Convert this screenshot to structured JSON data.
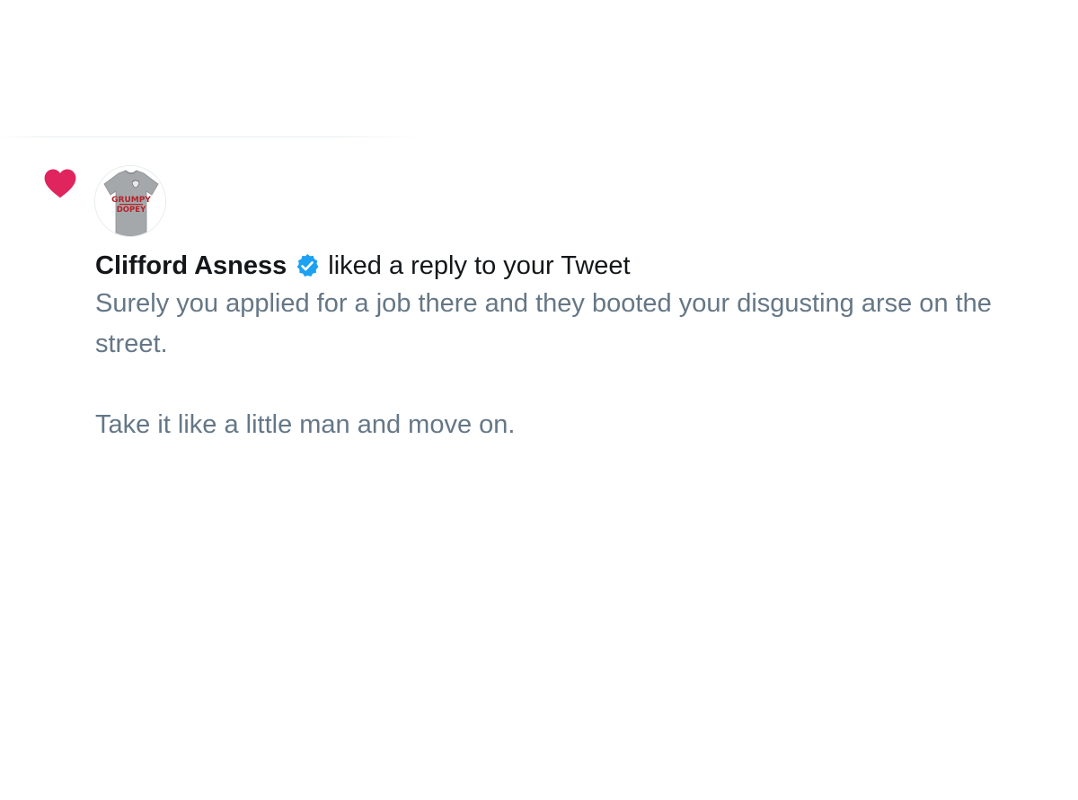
{
  "notification": {
    "type_icon": "heart-icon",
    "avatar_icon": "t-shirt-avatar",
    "avatar_text_line1": "GRUMPY",
    "avatar_text_line2": "DOPEY",
    "user_name": "Clifford Asness",
    "verified_icon": "verified-badge-icon",
    "action_text": "liked a reply to your Tweet",
    "tweet_text": "Surely you applied for a job there and they booted your disgusting arse on the street.\n\nTake it like a little man and move on."
  },
  "colors": {
    "heart": "#e0245e",
    "verified": "#1da1f2",
    "name_text": "#14171a",
    "tweet_text": "#657786",
    "background": "#ffffff"
  }
}
